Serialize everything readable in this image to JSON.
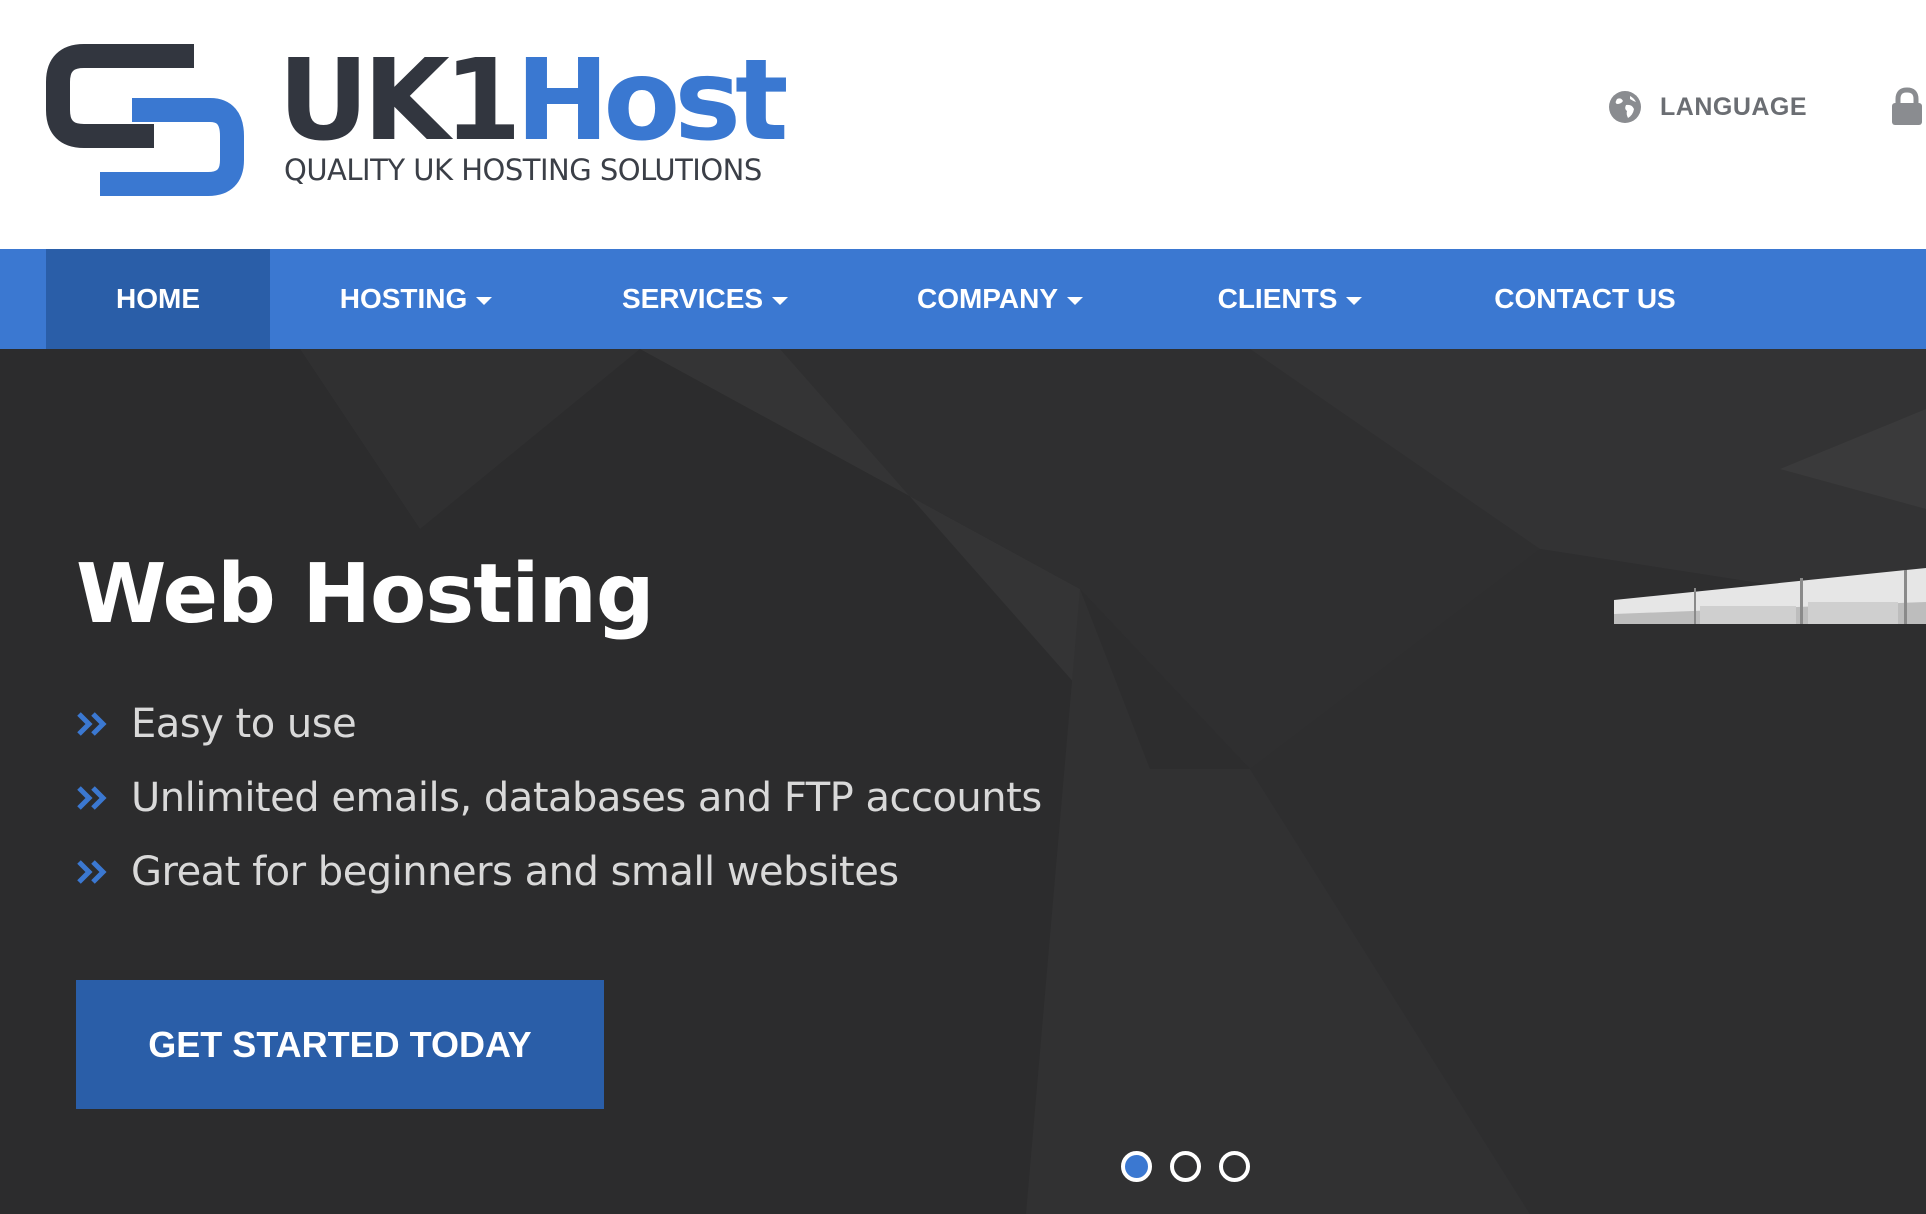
{
  "brand": {
    "name_part1": "UK1",
    "name_part2": "Host",
    "tagline": "QUALITY UK HOSTING SOLUTIONS",
    "colors": {
      "dark": "#32363f",
      "blue": "#3a78d1"
    }
  },
  "topbar": {
    "language_label": "LANGUAGE",
    "language_icon": "globe-icon",
    "account_icon": "lock-icon"
  },
  "nav": {
    "items": [
      {
        "label": "HOME",
        "active": true,
        "dropdown": false
      },
      {
        "label": "HOSTING",
        "active": false,
        "dropdown": true
      },
      {
        "label": "SERVICES",
        "active": false,
        "dropdown": true
      },
      {
        "label": "COMPANY",
        "active": false,
        "dropdown": true
      },
      {
        "label": "CLIENTS",
        "active": false,
        "dropdown": true
      },
      {
        "label": "CONTACT US",
        "active": false,
        "dropdown": false
      }
    ],
    "colors": {
      "bar": "#3b78d1",
      "active": "#2a5ea8"
    }
  },
  "hero": {
    "title": "Web Hosting",
    "features": [
      "Easy to use",
      "Unlimited emails, databases and FTP accounts",
      "Great for beginners and small websites"
    ],
    "feature_icon": "double-chevron-right-icon",
    "cta_label": "GET STARTED TODAY",
    "slides": {
      "count": 3,
      "active_index": 0
    },
    "colors": {
      "background": "#2f2f30",
      "cta": "#2a5ea8"
    }
  }
}
